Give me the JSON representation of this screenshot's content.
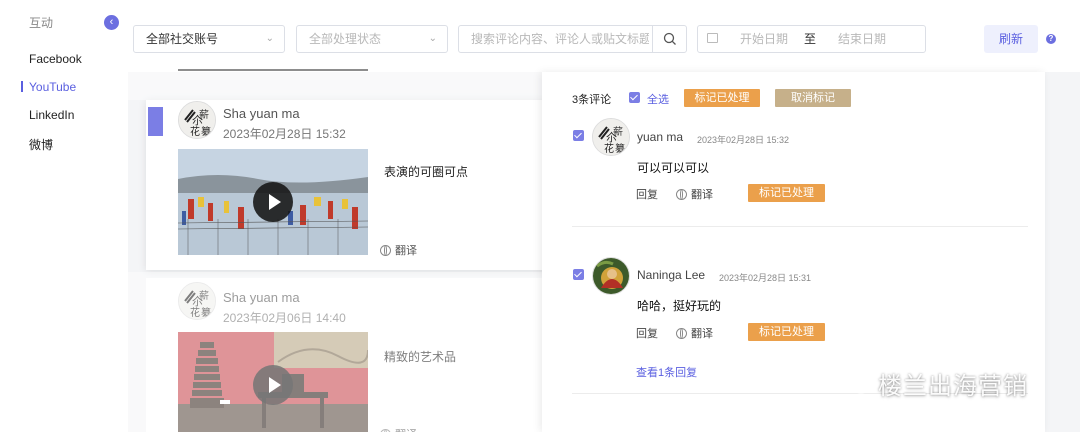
{
  "sidebar": {
    "section_title": "互动",
    "collapse_glyph": "‹",
    "items": [
      {
        "label": "Facebook"
      },
      {
        "label": "YouTube"
      },
      {
        "label": "LinkedIn"
      },
      {
        "label": "微博"
      }
    ],
    "active_index": 1
  },
  "filters": {
    "account_select": "全部社交账号",
    "status_select": "全部处理状态",
    "search_placeholder": "搜索评论内容、评论人或贴文标题",
    "date_start": "开始日期",
    "date_to": "至",
    "date_end": "结束日期",
    "refresh": "刷新",
    "help": "?"
  },
  "posts": [
    {
      "author": "Sha yuan ma",
      "time": "2023年02月28日 15:32",
      "text": "表演的可圈可点",
      "translate": "翻译",
      "selected": true
    },
    {
      "author": "Sha yuan ma",
      "time": "2023年02月06日 14:40",
      "text": "精致的艺术品",
      "translate": "翻译",
      "selected": false
    }
  ],
  "panel": {
    "count": "3条评论",
    "select_all": "全选",
    "mark_done": "标记已处理",
    "unmark": "取消标记",
    "comments": [
      {
        "name": "yuan ma",
        "time": "2023年02月28日 15:32",
        "text": "可以可以可以",
        "reply": "回复",
        "translate": "翻译",
        "status": "标记已处理"
      },
      {
        "name": "Naninga Lee",
        "time": "2023年02月28日 15:31",
        "text": "哈哈，挺好玩的",
        "reply": "回复",
        "translate": "翻译",
        "status": "标记已处理",
        "view_replies": "查看1条回复"
      }
    ]
  },
  "watermark": "楼兰出海营销",
  "colors": {
    "accent": "#5a5fe0",
    "orange": "#eba04b",
    "tan": "#c6b08a"
  }
}
